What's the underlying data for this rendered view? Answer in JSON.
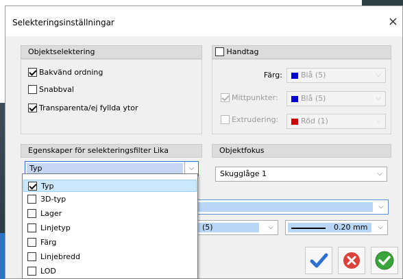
{
  "window": {
    "title": "Selekteringsinställningar",
    "close_glyph": "×"
  },
  "objektselektering": {
    "header": "Objektselektering",
    "options": [
      {
        "label": "Bakvänd ordning",
        "checked": true
      },
      {
        "label": "Snabbval",
        "checked": false
      },
      {
        "label": "Transparenta/ej fyllda ytor",
        "checked": true
      }
    ]
  },
  "handtag": {
    "header": "Handtag",
    "checked": false,
    "farg_label": "Färg:",
    "farg_value": "Blå (5)",
    "farg_color": "#0000cc",
    "mittpunkter_label": "Mittpunkter:",
    "mittpunkter_checked": true,
    "mittpunkter_value": "Blå (5)",
    "mittpunkter_color": "#0000cc",
    "extrudering_label": "Extrudering:",
    "extrudering_checked": false,
    "extrudering_value": "Röd (1)",
    "extrudering_color": "#cc0000"
  },
  "filter": {
    "header": "Egenskaper för selekteringsfilter Lika",
    "selected": "Typ",
    "items": [
      {
        "label": "Typ",
        "checked": true
      },
      {
        "label": "3D-typ",
        "checked": false
      },
      {
        "label": "Lager",
        "checked": false
      },
      {
        "label": "Linjetyp",
        "checked": false
      },
      {
        "label": "Färg",
        "checked": false
      },
      {
        "label": "Linjebredd",
        "checked": false
      },
      {
        "label": "LOD",
        "checked": false
      }
    ]
  },
  "objektfokus": {
    "header": "Objektfokus",
    "value": "Skugglåge 1"
  },
  "lower": {
    "color_value_partial": "(5)",
    "line_width": "0.20 mm"
  },
  "icons": {
    "ok": "checkmark-icon",
    "cancel": "cancel-icon",
    "apply": "apply-icon",
    "dropdown": "chevron-down-icon"
  },
  "colors": {
    "accent_blue": "#2f6fd0",
    "selection": "#cce8ff",
    "cancel_red": "#d9413a",
    "apply_green": "#3aa53a"
  }
}
